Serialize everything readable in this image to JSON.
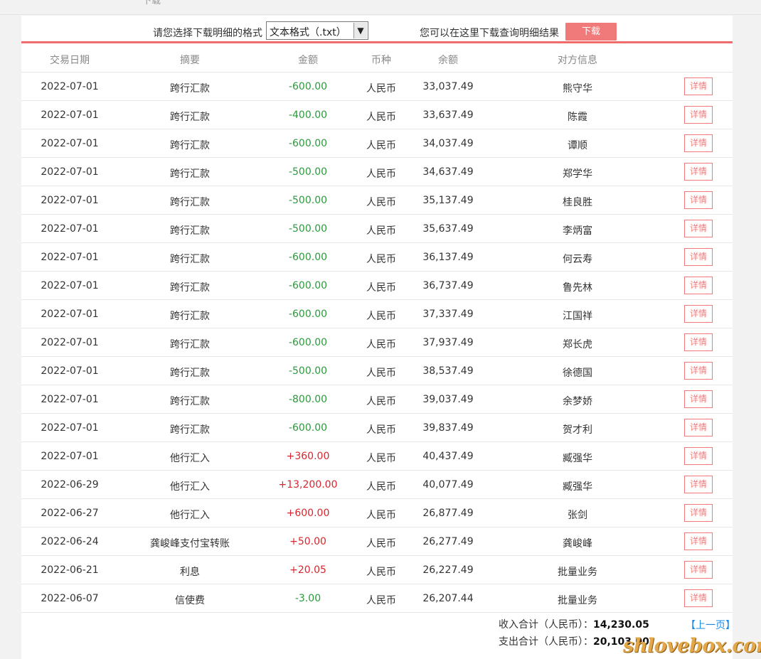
{
  "download": {
    "label": "请您选择下载明细的格式",
    "format_selected": "文本格式（.txt）",
    "hint": "您可以在这里下载查询明细结果",
    "button": "下载"
  },
  "columns": [
    "交易日期",
    "摘要",
    "金额",
    "币种",
    "余额",
    "对方信息"
  ],
  "rows": [
    {
      "date": "2022-07-01",
      "summary": "跨行汇款",
      "amount": "-600.00",
      "sign": "neg",
      "currency": "人民币",
      "balance": "33,037.49",
      "party": "熊守华",
      "detail": "详情"
    },
    {
      "date": "2022-07-01",
      "summary": "跨行汇款",
      "amount": "-400.00",
      "sign": "neg",
      "currency": "人民币",
      "balance": "33,637.49",
      "party": "陈霞",
      "detail": "详情"
    },
    {
      "date": "2022-07-01",
      "summary": "跨行汇款",
      "amount": "-600.00",
      "sign": "neg",
      "currency": "人民币",
      "balance": "34,037.49",
      "party": "谭顺",
      "detail": "详情"
    },
    {
      "date": "2022-07-01",
      "summary": "跨行汇款",
      "amount": "-500.00",
      "sign": "neg",
      "currency": "人民币",
      "balance": "34,637.49",
      "party": "郑学华",
      "detail": "详情"
    },
    {
      "date": "2022-07-01",
      "summary": "跨行汇款",
      "amount": "-500.00",
      "sign": "neg",
      "currency": "人民币",
      "balance": "35,137.49",
      "party": "桂良胜",
      "detail": "详情"
    },
    {
      "date": "2022-07-01",
      "summary": "跨行汇款",
      "amount": "-500.00",
      "sign": "neg",
      "currency": "人民币",
      "balance": "35,637.49",
      "party": "李炳富",
      "detail": "详情"
    },
    {
      "date": "2022-07-01",
      "summary": "跨行汇款",
      "amount": "-600.00",
      "sign": "neg",
      "currency": "人民币",
      "balance": "36,137.49",
      "party": "何云寿",
      "detail": "详情"
    },
    {
      "date": "2022-07-01",
      "summary": "跨行汇款",
      "amount": "-600.00",
      "sign": "neg",
      "currency": "人民币",
      "balance": "36,737.49",
      "party": "鲁先林",
      "detail": "详情"
    },
    {
      "date": "2022-07-01",
      "summary": "跨行汇款",
      "amount": "-600.00",
      "sign": "neg",
      "currency": "人民币",
      "balance": "37,337.49",
      "party": "江国祥",
      "detail": "详情"
    },
    {
      "date": "2022-07-01",
      "summary": "跨行汇款",
      "amount": "-600.00",
      "sign": "neg",
      "currency": "人民币",
      "balance": "37,937.49",
      "party": "郑长虎",
      "detail": "详情"
    },
    {
      "date": "2022-07-01",
      "summary": "跨行汇款",
      "amount": "-500.00",
      "sign": "neg",
      "currency": "人民币",
      "balance": "38,537.49",
      "party": "徐德国",
      "detail": "详情"
    },
    {
      "date": "2022-07-01",
      "summary": "跨行汇款",
      "amount": "-800.00",
      "sign": "neg",
      "currency": "人民币",
      "balance": "39,037.49",
      "party": "余梦娇",
      "detail": "详情"
    },
    {
      "date": "2022-07-01",
      "summary": "跨行汇款",
      "amount": "-600.00",
      "sign": "neg",
      "currency": "人民币",
      "balance": "39,837.49",
      "party": "贺才利",
      "detail": "详情"
    },
    {
      "date": "2022-07-01",
      "summary": "他行汇入",
      "amount": "+360.00",
      "sign": "pos",
      "currency": "人民币",
      "balance": "40,437.49",
      "party": "臧强华",
      "detail": "详情"
    },
    {
      "date": "2022-06-29",
      "summary": "他行汇入",
      "amount": "+13,200.00",
      "sign": "pos",
      "currency": "人民币",
      "balance": "40,077.49",
      "party": "臧强华",
      "detail": "详情"
    },
    {
      "date": "2022-06-27",
      "summary": "他行汇入",
      "amount": "+600.00",
      "sign": "pos",
      "currency": "人民币",
      "balance": "26,877.49",
      "party": "张剑",
      "detail": "详情"
    },
    {
      "date": "2022-06-24",
      "summary": "龚峻峰支付宝转账",
      "amount": "+50.00",
      "sign": "pos",
      "currency": "人民币",
      "balance": "26,277.49",
      "party": "龚峻峰",
      "detail": "详情"
    },
    {
      "date": "2022-06-21",
      "summary": "利息",
      "amount": "+20.05",
      "sign": "pos",
      "currency": "人民币",
      "balance": "26,227.49",
      "party": "批量业务",
      "detail": "详情"
    },
    {
      "date": "2022-06-07",
      "summary": "信使费",
      "amount": "-3.00",
      "sign": "neg",
      "currency": "人民币",
      "balance": "26,207.44",
      "party": "批量业务",
      "detail": "详情"
    }
  ],
  "totals": {
    "income_label": "收入合计（人民币）：",
    "income_value": "14,230.05",
    "expense_label": "支出合计（人民币）：",
    "expense_value": "20,103.00",
    "prev_page": "【上一页】"
  },
  "colors": {
    "accent": "#f07a7a",
    "negative_amount": "#2a9a3a",
    "positive_amount": "#d7262e",
    "link": "#1a8be8"
  },
  "watermark": "shlovebox.com"
}
